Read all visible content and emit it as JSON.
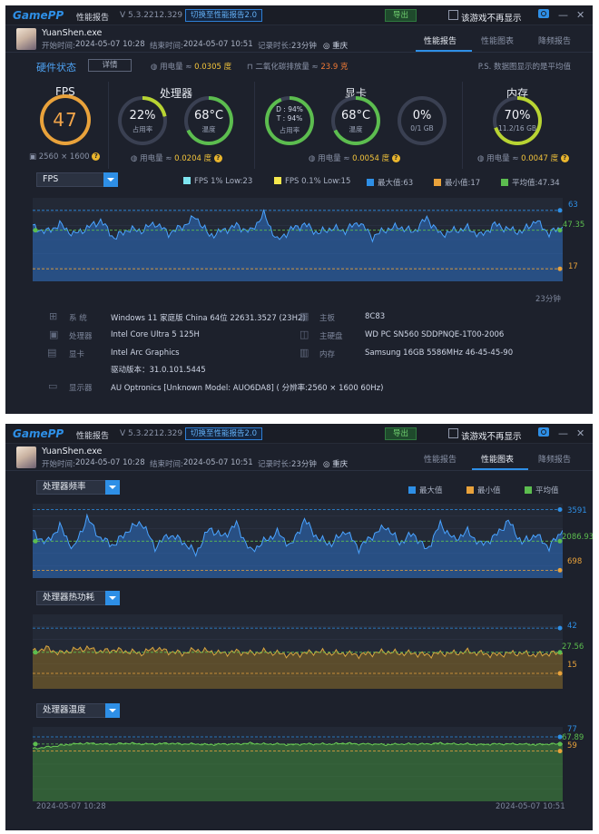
{
  "app": {
    "logo_a": "Game",
    "logo_b": "PP",
    "title": "性能报告",
    "version": "V 5.3.2212.329",
    "switch_label": "切换至性能报告2.0",
    "export_label": "导出",
    "noshow_label": "该游戏不再显示",
    "process": "YuanShen.exe",
    "start_label": "开始时间:",
    "start_value": "2024-05-07 10:28",
    "end_label": "结束时间:",
    "end_value": "2024-05-07 10:51",
    "duration_label": "记录时长:",
    "duration_value": "23分钟",
    "location": "重庆",
    "tabs": [
      "性能报告",
      "性能图表",
      "降频报告"
    ],
    "icons": {
      "camera": "camera-icon",
      "minimize": "minimize-icon",
      "close": "close-icon",
      "pin": "location-pin-icon"
    }
  },
  "report": {
    "hw_title": "硬件状态",
    "detail_label": "详情",
    "power_label": "用电量 ≈",
    "power_value": "0.0305 度",
    "co2_label": "二氧化碳排放量 ≈",
    "co2_value": "23.9 克",
    "ps_note": "P.S. 数据图显示的是平均值",
    "fps": {
      "title": "FPS",
      "value": "47",
      "resolution": "2560 × 1600"
    },
    "cpu": {
      "title": "处理器",
      "usage": "22%",
      "usage_label": "占用率",
      "temp": "68°C",
      "temp_label": "温度",
      "power_label": "用电量 ≈",
      "power_value": "0.0204 度",
      "usage_fraction": 0.22,
      "temp_fraction": 0.68
    },
    "gpu": {
      "title": "显卡",
      "d_line": "D : 94%",
      "t_line": "T : 94%",
      "usage_label": "占用率",
      "temp": "68°C",
      "temp_label": "温度",
      "vram": "0%",
      "vram_sub": "0/1 GB",
      "power_label": "用电量 ≈",
      "power_value": "0.0054 度",
      "usage_fraction": 0.94,
      "temp_fraction": 0.68,
      "vram_fraction": 0.0
    },
    "mem": {
      "title": "内存",
      "value": "70%",
      "sub": "11.2/16 GB",
      "power_label": "用电量 ≈",
      "power_value": "0.0047 度",
      "fraction": 0.7
    },
    "colors": {
      "blue": "#2e8fe6",
      "yellow_green": "#b8d433",
      "green": "#5cbd4f",
      "orange": "#e9a23b"
    }
  },
  "fps_chart": {
    "selector": "FPS",
    "legend": [
      "FPS 1% Low:23",
      "FPS 0.1% Low:15",
      "最大值:63",
      "最小值:17",
      "平均值:47.34"
    ],
    "legend_colors": [
      "#7ee5f0",
      "#f5e84d",
      "#2e8fe6",
      "#e9a23b",
      "#5cbd4f"
    ],
    "max_label": "63",
    "avg_label": "47.35",
    "min_label": "17",
    "time_label": "23分钟"
  },
  "sysinfo": [
    {
      "icon": "windows-icon",
      "key": "系 统",
      "value": "Windows 11 家庭版 China 64位 22631.3527 (23H2)"
    },
    {
      "icon": "cpu-icon",
      "key": "处理器",
      "value": "Intel Core Ultra 5 125H"
    },
    {
      "icon": "gpu-icon",
      "key": "显卡",
      "value": "Intel Arc Graphics"
    },
    {
      "icon": "monitor-icon",
      "key": "显示器",
      "value": "AU Optronics [Unknown Model: AUO6DA8] ( 分辨率:2560 × 1600 60Hz)"
    }
  ],
  "sysinfo_right": [
    {
      "icon": "motherboard-icon",
      "key": "主板",
      "value": "8C83"
    },
    {
      "icon": "disk-icon",
      "key": "主硬盘",
      "value": "WD PC SN560 SDDPNQE-1T00-2006"
    },
    {
      "icon": "memory-icon",
      "key": "内存",
      "value": "Samsung 16GB 5586MHz 46-45-45-90"
    }
  ],
  "driver": "驱动版本：31.0.101.5445",
  "charts_page": {
    "legend": [
      "最大值",
      "最小值",
      "平均值"
    ],
    "legend_colors": [
      "#2e8fe6",
      "#e9a23b",
      "#5cbd4f"
    ],
    "freq": {
      "selector": "处理器频率",
      "max": "3591",
      "avg": "2086.93",
      "min": "698"
    },
    "power": {
      "selector": "处理器热功耗",
      "max": "42",
      "avg": "27.56",
      "min": "15"
    },
    "temp": {
      "selector": "处理器温度",
      "max": "77",
      "avg": "67.89",
      "min": "59"
    },
    "time_start": "2024-05-07 10:28",
    "time_end": "2024-05-07 10:51"
  },
  "chart_data": [
    {
      "type": "area",
      "title": "FPS",
      "series": [
        {
          "name": "FPS",
          "values": [
            50,
            46,
            52,
            44,
            49,
            55,
            41,
            48,
            47,
            53,
            45,
            50,
            58,
            43,
            47,
            51,
            46,
            60,
            39,
            48,
            52,
            45,
            49,
            47,
            54,
            42,
            48,
            50,
            46,
            57,
            44,
            47,
            49,
            43,
            52,
            48,
            46,
            55,
            45,
            50
          ]
        }
      ],
      "ylim": [
        0,
        70
      ],
      "max": 63,
      "min": 17,
      "avg": 47.34,
      "low_1pct": 23,
      "low_01pct": 15
    },
    {
      "type": "area",
      "title": "处理器频率",
      "series": [
        {
          "name": "处理器频率",
          "values": [
            2500,
            2000,
            2800,
            1700,
            3200,
            2200,
            1900,
            2600,
            3000,
            1800,
            2400,
            2100,
            1500,
            2700,
            2300,
            2900,
            1600,
            2050,
            2500,
            1850,
            3100,
            2200,
            1950,
            2600,
            1750,
            2350,
            2800,
            2000,
            2450,
            1650,
            2900,
            2150,
            2550,
            1900,
            2300,
            3050,
            2000,
            2400,
            1800,
            2600
          ]
        }
      ],
      "max": 3591,
      "min": 698,
      "avg": 2086.93
    },
    {
      "type": "area",
      "title": "处理器热功耗",
      "series": [
        {
          "name": "处理器热功耗",
          "values": [
            28,
            30,
            27,
            29,
            30,
            28,
            29,
            28,
            27,
            30,
            28,
            27,
            29,
            28,
            27,
            28,
            27,
            28,
            27,
            26,
            27,
            28,
            27,
            27,
            26,
            27,
            28,
            27,
            27,
            26,
            27,
            27,
            28,
            27,
            26,
            27,
            27,
            26,
            27,
            27
          ]
        }
      ],
      "max": 42,
      "min": 15,
      "avg": 27.56
    },
    {
      "type": "area",
      "title": "处理器温度",
      "series": [
        {
          "name": "处理器温度",
          "values": [
            62,
            64,
            66,
            68,
            69,
            68,
            68,
            69,
            68,
            68,
            69,
            68,
            68,
            67,
            68,
            68,
            69,
            68,
            68,
            67,
            68,
            68,
            68,
            69,
            68,
            68,
            67,
            68,
            68,
            68,
            69,
            68,
            68,
            67,
            68,
            68,
            68,
            67,
            68,
            68
          ]
        }
      ],
      "max": 77,
      "min": 59,
      "avg": 67.89
    }
  ]
}
